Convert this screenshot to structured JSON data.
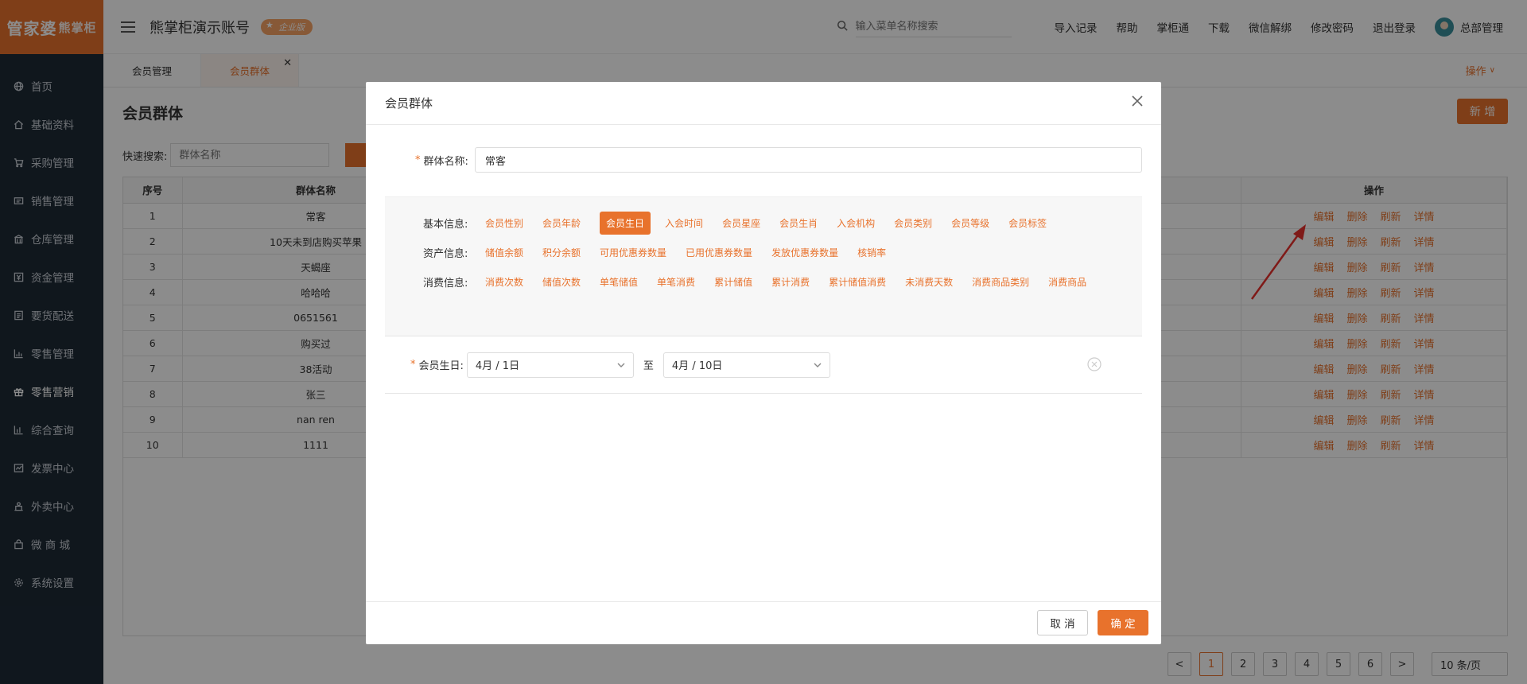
{
  "brand": {
    "logo_main": "管家婆",
    "logo_sub": "熊掌柜"
  },
  "sidebar": {
    "items": [
      {
        "label": "首页",
        "icon": "globe-icon"
      },
      {
        "label": "基础资料",
        "icon": "home-icon"
      },
      {
        "label": "采购管理",
        "icon": "cart-icon"
      },
      {
        "label": "销售管理",
        "icon": "sales-icon"
      },
      {
        "label": "仓库管理",
        "icon": "warehouse-icon"
      },
      {
        "label": "资金管理",
        "icon": "money-icon"
      },
      {
        "label": "要货配送",
        "icon": "delivery-icon"
      },
      {
        "label": "零售管理",
        "icon": "chart-icon"
      },
      {
        "label": "零售营销",
        "icon": "gift-icon"
      },
      {
        "label": "综合查询",
        "icon": "query-icon"
      },
      {
        "label": "发票中心",
        "icon": "invoice-icon"
      },
      {
        "label": "外卖中心",
        "icon": "takeout-icon"
      },
      {
        "label": "微 商 城",
        "icon": "shop-icon"
      },
      {
        "label": "系统设置",
        "icon": "gear-icon"
      }
    ],
    "active_index": 8
  },
  "header": {
    "account_title": "熊掌柜演示账号",
    "edition_badge": "企业版",
    "search_placeholder": "输入菜单名称搜索",
    "links": [
      "导入记录",
      "帮助",
      "掌柜通",
      "下载",
      "微信解绑",
      "修改密码",
      "退出登录"
    ],
    "user_name": "总部管理"
  },
  "tabs": {
    "items": [
      "会员管理",
      "会员群体"
    ],
    "active_index": 1,
    "ops_label": "操作"
  },
  "content": {
    "page_title": "会员群体",
    "add_label": "新 增",
    "quick_label": "快速搜索:",
    "quick_placeholder": "群体名称",
    "columns": {
      "seq": "序号",
      "name": "群体名称",
      "ops": "操作"
    },
    "rows": [
      {
        "seq": "1",
        "name": "常客"
      },
      {
        "seq": "2",
        "name": "10天未到店购买苹果"
      },
      {
        "seq": "3",
        "name": "天蝎座"
      },
      {
        "seq": "4",
        "name": "哈哈哈"
      },
      {
        "seq": "5",
        "name": "0651561"
      },
      {
        "seq": "6",
        "name": "购买过"
      },
      {
        "seq": "7",
        "name": "38活动"
      },
      {
        "seq": "8",
        "name": "张三"
      },
      {
        "seq": "9",
        "name": "nan ren"
      },
      {
        "seq": "10",
        "name": "1111"
      }
    ],
    "row_ops": [
      "编辑",
      "删除",
      "刷新",
      "详情"
    ],
    "pager": {
      "pages": [
        "1",
        "2",
        "3",
        "4",
        "5",
        "6"
      ],
      "current": "1",
      "prev": "<",
      "next": ">",
      "page_size": "10 条/页"
    }
  },
  "modal": {
    "title": "会员群体",
    "name_label": "群体名称:",
    "name_value": "常客",
    "groups": [
      {
        "label": "基本信息:",
        "chips": [
          "会员性别",
          "会员年龄",
          "会员生日",
          "入会时间",
          "会员星座",
          "会员生肖",
          "入会机构",
          "会员类别",
          "会员等级",
          "会员标签"
        ],
        "selected": 2
      },
      {
        "label": "资产信息:",
        "chips": [
          "储值余额",
          "积分余额",
          "可用优惠券数量",
          "已用优惠券数量",
          "发放优惠券数量",
          "核销率"
        ],
        "selected": -1
      },
      {
        "label": "消费信息:",
        "chips": [
          "消费次数",
          "储值次数",
          "单笔储值",
          "单笔消费",
          "累计储值",
          "累计消费",
          "累计储值消费",
          "未消费天数",
          "消费商品类别",
          "消费商品"
        ],
        "selected": -1
      }
    ],
    "birthday": {
      "label": "会员生日:",
      "from": "4月 / 1日",
      "to_label": "至",
      "to": "4月 / 10日"
    },
    "cancel_label": "取 消",
    "ok_label": "确 定"
  },
  "colors": {
    "accent": "#e8722c",
    "sidebar": "#1e2a36"
  }
}
